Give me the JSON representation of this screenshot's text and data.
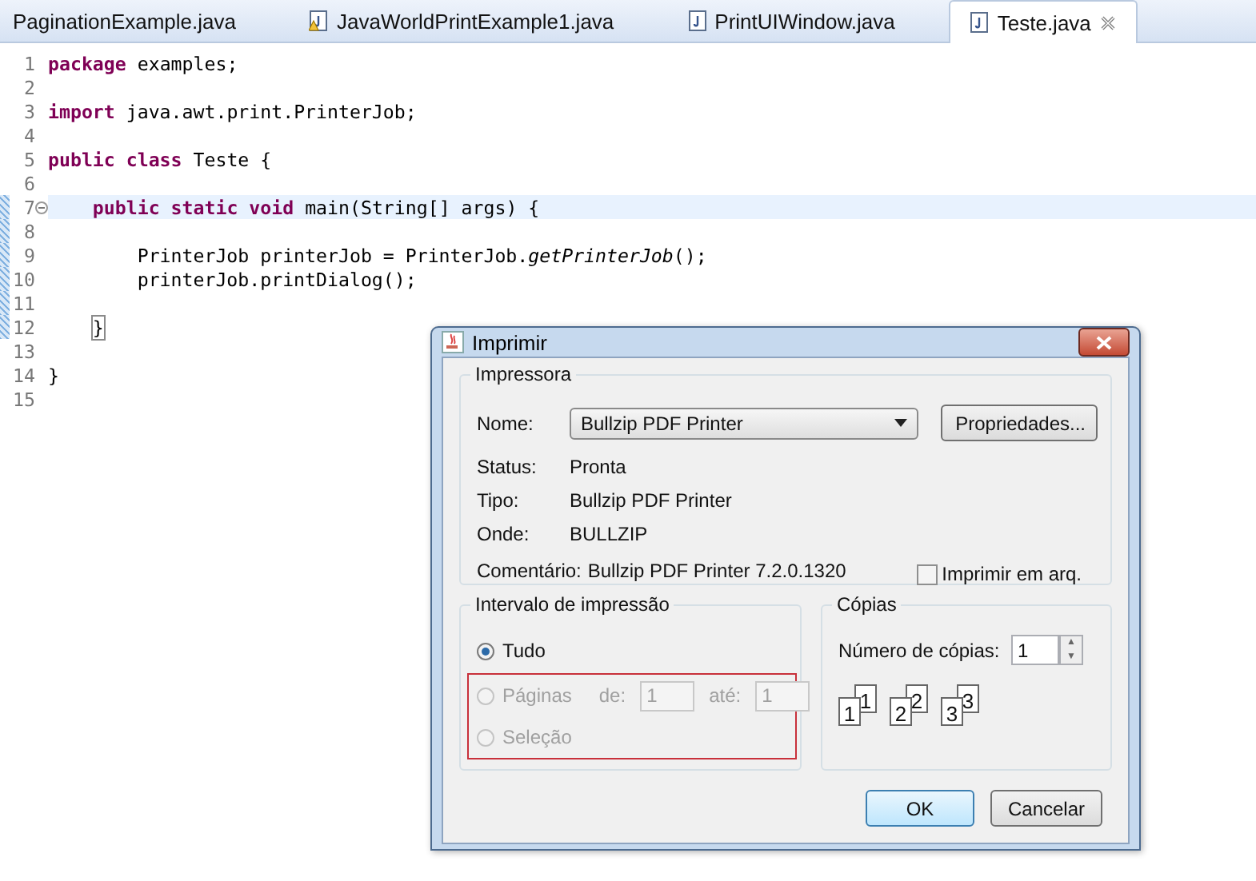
{
  "tabs": [
    {
      "label": "PaginationExample.java",
      "kind": "plain",
      "selected": false,
      "closable": false
    },
    {
      "label": "JavaWorldPrintExample1.java",
      "kind": "warning",
      "selected": false,
      "closable": false
    },
    {
      "label": "PrintUIWindow.java",
      "kind": "java",
      "selected": false,
      "closable": false
    },
    {
      "label": "Teste.java",
      "kind": "java",
      "selected": true,
      "closable": true
    }
  ],
  "editor": {
    "lines": [
      {
        "number": "1",
        "current": false,
        "changed": false,
        "foldable": false,
        "tokens": [
          {
            "kind": "keyword",
            "text": "package"
          },
          {
            "kind": "plain",
            "text": " examples;"
          }
        ]
      },
      {
        "number": "2",
        "current": false,
        "changed": false,
        "foldable": false
      },
      {
        "number": "3",
        "current": false,
        "changed": false,
        "foldable": false,
        "tokens": [
          {
            "kind": "keyword",
            "text": "import"
          },
          {
            "kind": "plain",
            "text": " java.awt.print.PrinterJob;"
          }
        ]
      },
      {
        "number": "4",
        "current": false,
        "changed": false,
        "foldable": false
      },
      {
        "number": "5",
        "current": false,
        "changed": false,
        "foldable": false,
        "tokens": [
          {
            "kind": "keyword",
            "text": "public"
          },
          {
            "kind": "keyword",
            "text": " class"
          },
          {
            "kind": "plain",
            "text": " Teste {"
          }
        ]
      },
      {
        "number": "6",
        "current": false,
        "changed": false,
        "foldable": false
      },
      {
        "number": "7",
        "current": true,
        "changed": true,
        "foldable": true,
        "tokens": [
          {
            "kind": "keyword",
            "text": "    public"
          },
          {
            "kind": "keyword",
            "text": " static"
          },
          {
            "kind": "keyword",
            "text": " void"
          },
          {
            "kind": "plain",
            "text": " main(String[] args) {"
          }
        ]
      },
      {
        "number": "8",
        "current": false,
        "changed": true,
        "foldable": false
      },
      {
        "number": "9",
        "current": false,
        "changed": true,
        "foldable": false,
        "tokens": [
          {
            "kind": "plain",
            "text": "        PrinterJob printerJob = PrinterJob."
          },
          {
            "kind": "static",
            "text": "getPrinterJob"
          },
          {
            "kind": "plain",
            "text": "();"
          }
        ]
      },
      {
        "number": "10",
        "current": false,
        "changed": true,
        "foldable": false,
        "tokens": [
          {
            "kind": "plain",
            "text": "        printerJob.printDialog();"
          }
        ]
      },
      {
        "number": "11",
        "current": false,
        "changed": true,
        "foldable": false
      },
      {
        "number": "12",
        "current": false,
        "changed": true,
        "foldable": false,
        "tokens": [
          {
            "kind": "bracket",
            "text": "    }"
          }
        ]
      },
      {
        "number": "13",
        "current": false,
        "changed": false,
        "foldable": false
      },
      {
        "number": "14",
        "current": false,
        "changed": false,
        "foldable": false,
        "tokens": [
          {
            "kind": "plain",
            "text": "}"
          }
        ]
      },
      {
        "number": "15",
        "current": false,
        "changed": false,
        "foldable": false
      }
    ]
  },
  "dialog": {
    "title": "Imprimir",
    "printer_group": {
      "title": "Impressora",
      "name_label": "Nome:",
      "name_value": "Bullzip PDF Printer",
      "properties_button": "Propriedades...",
      "info": [
        {
          "label": "Status:",
          "value": "Pronta"
        },
        {
          "label": "Tipo:",
          "value": "Bullzip PDF Printer"
        },
        {
          "label": "Onde:",
          "value": "BULLZIP"
        },
        {
          "label": "Comentário:",
          "value": "Bullzip PDF Printer 7.2.0.1320"
        }
      ],
      "print_to_file": {
        "label": "Imprimir em arq.",
        "checked": false
      }
    },
    "range_group": {
      "title": "Intervalo de impressão",
      "options": [
        {
          "label": "Tudo",
          "selected": true,
          "disabled": false
        },
        {
          "label": "Páginas",
          "selected": false,
          "disabled": true
        },
        {
          "label": "Seleção",
          "selected": false,
          "disabled": true
        }
      ],
      "from_label": "de:",
      "from_value": "1",
      "to_label": "até:",
      "to_value": "1",
      "fields_disabled": true
    },
    "copies_group": {
      "title": "Cópias",
      "count_label": "Número de cópias:",
      "count_value": "1",
      "spinner_up": "▲",
      "spinner_down": "▼",
      "collate_pages": [
        {
          "back": "1",
          "front": "1"
        },
        {
          "back": "2",
          "front": "2"
        },
        {
          "back": "3",
          "front": "3"
        }
      ]
    },
    "buttons": [
      {
        "label": "OK",
        "default": true
      },
      {
        "label": "Cancelar",
        "default": false
      }
    ]
  }
}
